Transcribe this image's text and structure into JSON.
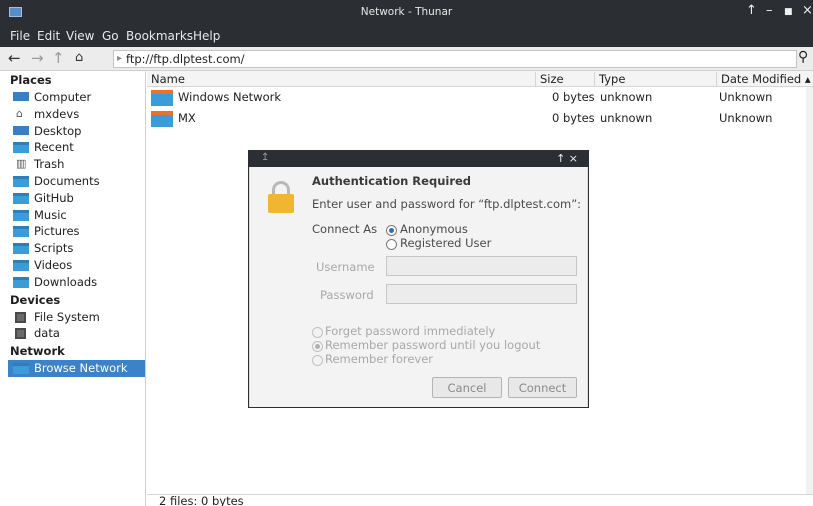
{
  "window": {
    "title": "Network - Thunar",
    "controls": {
      "pin": "↑",
      "minimize": "–",
      "maximize": "■",
      "close": "×"
    }
  },
  "menubar": {
    "file": "File",
    "edit": "Edit",
    "view": "View",
    "go": "Go",
    "bookmarks": "Bookmarks",
    "help": "Help"
  },
  "toolbar": {
    "back_icon": "left-arrow-icon",
    "forward_icon": "right-arrow-icon",
    "up_icon": "up-arrow-icon",
    "home_icon": "home-icon",
    "location": "ftp://ftp.dlptest.com/",
    "search_icon": "search-icon"
  },
  "sidebar": {
    "places_heading": "Places",
    "places": [
      {
        "label": "Computer",
        "icon": "computer-icon"
      },
      {
        "label": "mxdevs",
        "icon": "home-icon"
      },
      {
        "label": "Desktop",
        "icon": "desktop-icon"
      },
      {
        "label": "Recent",
        "icon": "recent-folder-icon"
      },
      {
        "label": "Trash",
        "icon": "trash-icon"
      },
      {
        "label": "Documents",
        "icon": "documents-folder-icon"
      },
      {
        "label": "GitHub",
        "icon": "folder-icon"
      },
      {
        "label": "Music",
        "icon": "music-folder-icon"
      },
      {
        "label": "Pictures",
        "icon": "pictures-folder-icon"
      },
      {
        "label": "Scripts",
        "icon": "folder-icon"
      },
      {
        "label": "Videos",
        "icon": "videos-folder-icon"
      },
      {
        "label": "Downloads",
        "icon": "downloads-folder-icon"
      }
    ],
    "devices_heading": "Devices",
    "devices": [
      {
        "label": "File System",
        "icon": "drive-icon"
      },
      {
        "label": "data",
        "icon": "drive-icon"
      }
    ],
    "network_heading": "Network",
    "network": [
      {
        "label": "Browse Network",
        "icon": "network-folder-icon",
        "selected": true
      }
    ]
  },
  "columns": {
    "name": "Name",
    "size": "Size",
    "type": "Type",
    "date": "Date Modified",
    "sort_indicator": "▴"
  },
  "files": [
    {
      "name": "Windows Network",
      "size": "0 bytes",
      "type": "unknown",
      "date": "Unknown"
    },
    {
      "name": "MX",
      "size": "0 bytes",
      "type": "unknown",
      "date": "Unknown"
    }
  ],
  "status": "2 files: 0 bytes",
  "dialog": {
    "pin": "↥",
    "controls": "↑  ×",
    "heading": "Authentication Required",
    "prompt": "Enter user and password for “ftp.dlptest.com”:",
    "connect_as_label": "Connect As",
    "anonymous_label": "Anonymous",
    "registered_label": "Registered User",
    "username_label": "Username",
    "password_label": "Password",
    "username_value": "",
    "password_value": "",
    "forget_label": "Forget password immediately",
    "remember_logout_label": "Remember password until you logout",
    "remember_forever_label": "Remember forever",
    "cancel_label": "Cancel",
    "connect_label": "Connect"
  },
  "colors": {
    "titlebar": "#2b2e33",
    "selection": "#3b82c8",
    "folder": "#3a9cd8",
    "lock": "#f0b531"
  }
}
